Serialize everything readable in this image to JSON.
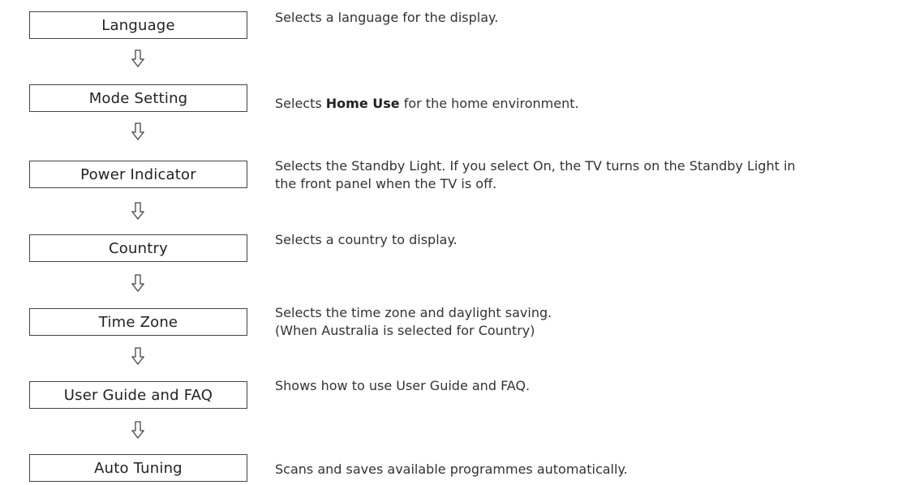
{
  "steps": [
    {
      "label": "Language",
      "description": [
        "Selects a language for the display."
      ]
    },
    {
      "label": "Mode Setting",
      "description_before": "Selects ",
      "description_bold": "Home Use",
      "description_after": " for the home environment."
    },
    {
      "label": "Power Indicator",
      "description": [
        "Selects the Standby Light. If you select On, the TV turns on the Standby Light in",
        "the front panel when the TV is off."
      ]
    },
    {
      "label": "Country",
      "description": [
        "Selects a country to display."
      ]
    },
    {
      "label": "Time Zone",
      "description": [
        "Selects the time zone and daylight saving.",
        "(When Australia is selected for Country)"
      ]
    },
    {
      "label": "User Guide and FAQ",
      "description": [
        "Shows how to use User Guide and FAQ."
      ]
    },
    {
      "label": "Auto Tuning",
      "description": [
        "Scans and saves available programmes automatically."
      ]
    }
  ],
  "arrow_icon": "down-arrow-icon",
  "colors": {
    "box_border": "#444444",
    "text": "#333333"
  }
}
